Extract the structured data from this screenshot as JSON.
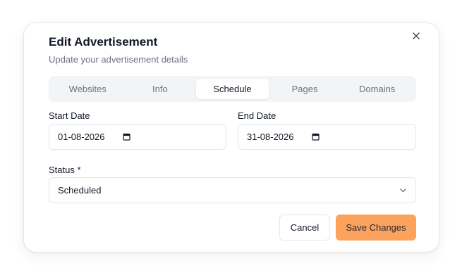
{
  "dialog": {
    "title": "Edit Advertisement",
    "subtitle": "Update your advertisement details",
    "close_icon": "close-icon"
  },
  "tabs": [
    {
      "label": "Websites",
      "active": false
    },
    {
      "label": "Info",
      "active": false
    },
    {
      "label": "Schedule",
      "active": true
    },
    {
      "label": "Pages",
      "active": false
    },
    {
      "label": "Domains",
      "active": false
    }
  ],
  "schedule": {
    "start_date_label": "Start Date",
    "start_date_value": "01-08-2026",
    "end_date_label": "End Date",
    "end_date_value": "31-08-2026",
    "calendar_icon": "calendar-icon"
  },
  "status": {
    "label": "Status *",
    "value": "Scheduled",
    "icon": "chevron-down-icon"
  },
  "actions": {
    "cancel_label": "Cancel",
    "save_label": "Save Changes"
  },
  "colors": {
    "accent": "#fba35c",
    "muted_text": "#6b7280",
    "tab_bg": "#f3f4f6",
    "border": "#e5e7eb"
  }
}
